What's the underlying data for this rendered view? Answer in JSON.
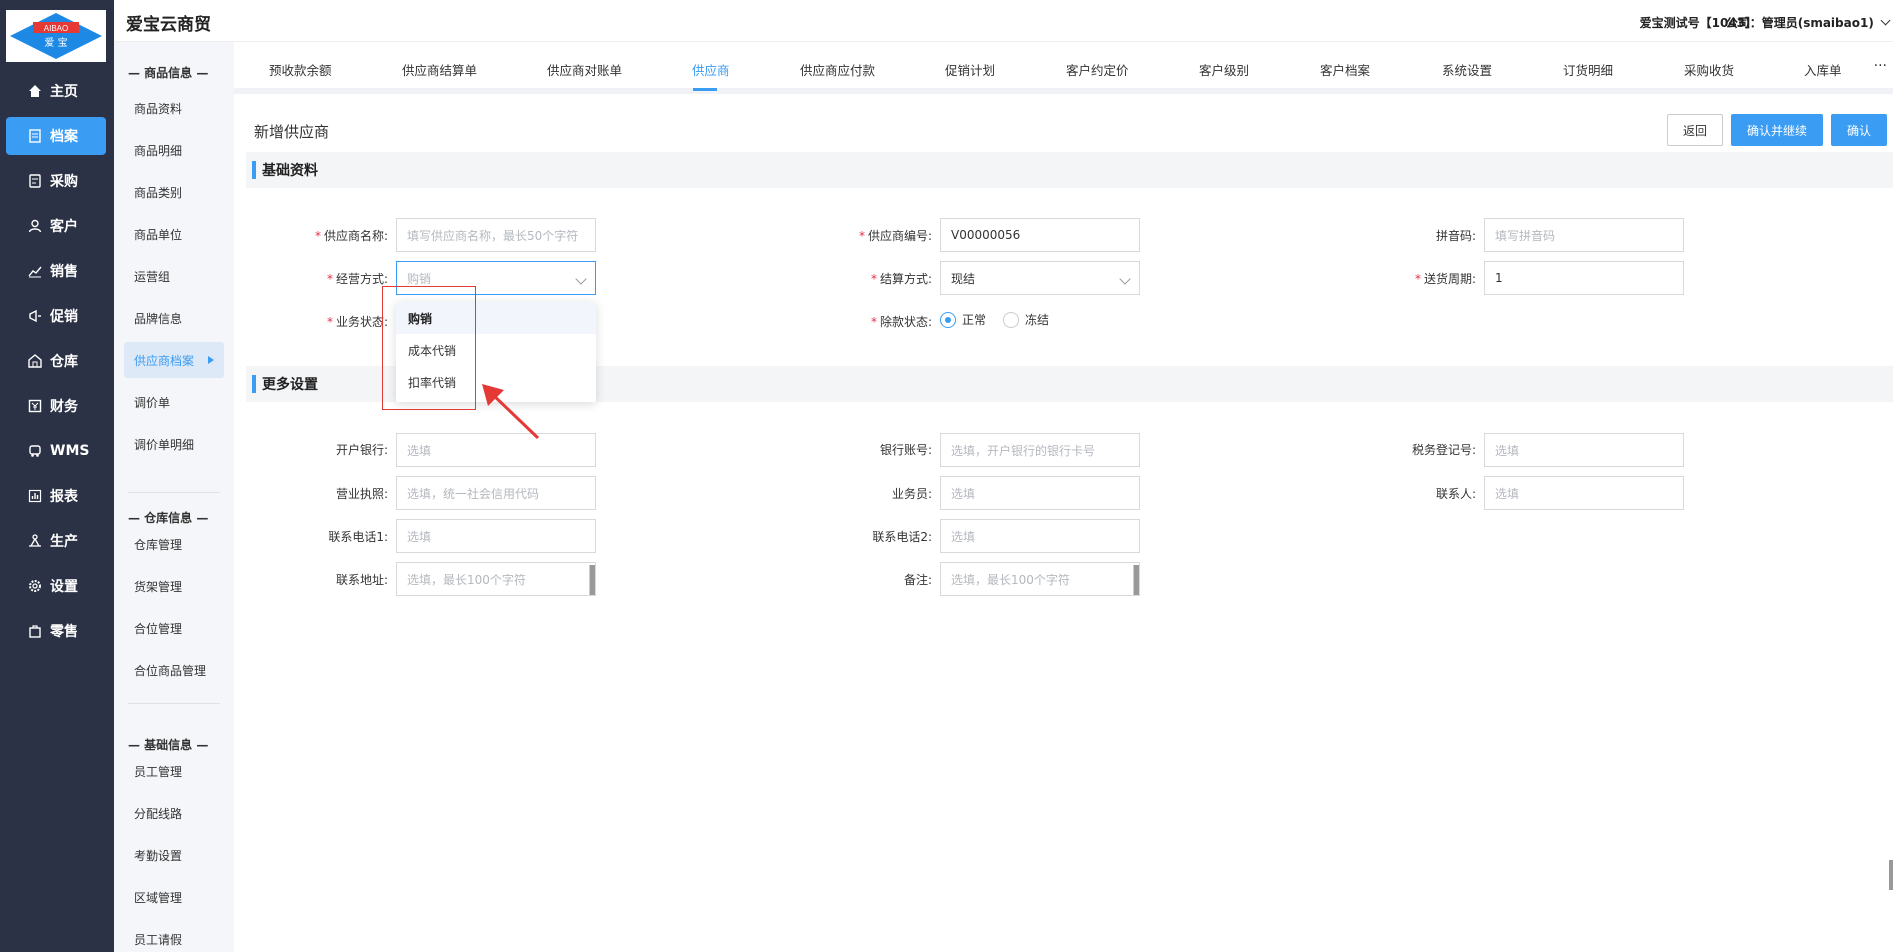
{
  "app": {
    "title": "爱宝云商贸",
    "logo_text_top": "AIBAO",
    "logo_text_bottom": "爱 宝"
  },
  "header": {
    "account": "爱宝测试号【1043】",
    "company": "公司：管理员(smaibao1)"
  },
  "main_nav": [
    {
      "label": "主页",
      "icon": "home-icon"
    },
    {
      "label": "档案",
      "icon": "archive-icon",
      "active": true
    },
    {
      "label": "采购",
      "icon": "purchase-icon"
    },
    {
      "label": "客户",
      "icon": "user-icon"
    },
    {
      "label": "销售",
      "icon": "chart-line-icon"
    },
    {
      "label": "促销",
      "icon": "megaphone-icon"
    },
    {
      "label": "仓库",
      "icon": "warehouse-icon"
    },
    {
      "label": "财务",
      "icon": "finance-icon"
    },
    {
      "label": "WMS",
      "icon": "truck-icon"
    },
    {
      "label": "报表",
      "icon": "bar-chart-icon"
    },
    {
      "label": "生产",
      "icon": "production-icon"
    },
    {
      "label": "设置",
      "icon": "gear-icon"
    },
    {
      "label": "零售",
      "icon": "bag-icon"
    }
  ],
  "sub_nav": {
    "group1": "— 商品信息 —",
    "items1": [
      "商品资料",
      "商品明细",
      "商品类别",
      "商品单位",
      "运营组",
      "品牌信息",
      "供应商档案",
      "调价单",
      "调价单明细"
    ],
    "group2": "— 仓库信息 —",
    "items2": [
      "仓库管理",
      "货架管理",
      "合位管理",
      "合位商品管理"
    ],
    "group3": "— 基础信息 —",
    "items3": [
      "员工管理",
      "分配线路",
      "考勤设置",
      "区域管理",
      "员工请假"
    ]
  },
  "tabs": [
    "预收款余额",
    "供应商结算单",
    "供应商对账单",
    "供应商",
    "供应商应付款",
    "促销计划",
    "客户约定价",
    "客户级别",
    "客户档案",
    "系统设置",
    "订货明细",
    "采购收货",
    "入库单"
  ],
  "tabs_more": "···",
  "page": {
    "title": "新增供应商",
    "btn_back": "返回",
    "btn_confirm_continue": "确认并继续",
    "btn_confirm": "确认"
  },
  "basic": {
    "section_title": "基础资料",
    "supplier_name_label": "供应商名称:",
    "supplier_name_placeholder": "填写供应商名称，最长50个字符",
    "supplier_code_label": "供应商编号:",
    "supplier_code_value": "V00000056",
    "pinyin_label": "拼音码:",
    "pinyin_placeholder": "填写拼音码",
    "mode_label": "经营方式:",
    "mode_placeholder": "购销",
    "settle_label": "结算方式:",
    "settle_value": "现结",
    "delivery_label": "送货周期:",
    "delivery_value": "1",
    "status_label": "业务状态:",
    "payment_status_label": "除款状态:",
    "payment_opt_normal": "正常",
    "payment_opt_frozen": "冻结"
  },
  "dropdown": {
    "options": [
      "购销",
      "成本代销",
      "扣率代销"
    ],
    "selected": "购销"
  },
  "more": {
    "section_title": "更多设置",
    "bank_label": "开户银行:",
    "bank_placeholder": "选填",
    "account_label": "银行账号:",
    "account_placeholder": "选填，开户银行的银行卡号",
    "tax_label": "税务登记号:",
    "tax_placeholder": "选填",
    "license_label": "营业执照:",
    "license_placeholder": "选填，统一社会信用代码",
    "salesman_label": "业务员:",
    "salesman_placeholder": "选填",
    "contact_label": "联系人:",
    "contact_placeholder": "选填",
    "phone1_label": "联系电话1:",
    "phone1_placeholder": "选填",
    "phone2_label": "联系电话2:",
    "phone2_placeholder": "选填",
    "address_label": "联系地址:",
    "address_placeholder": "选填，最长100个字符",
    "remark_label": "备注:",
    "remark_placeholder": "选填，最长100个字符"
  },
  "colors": {
    "primary": "#3a9cf3",
    "nav_bg": "#2b3245",
    "required": "#e5334b",
    "annotation": "#e53935"
  }
}
